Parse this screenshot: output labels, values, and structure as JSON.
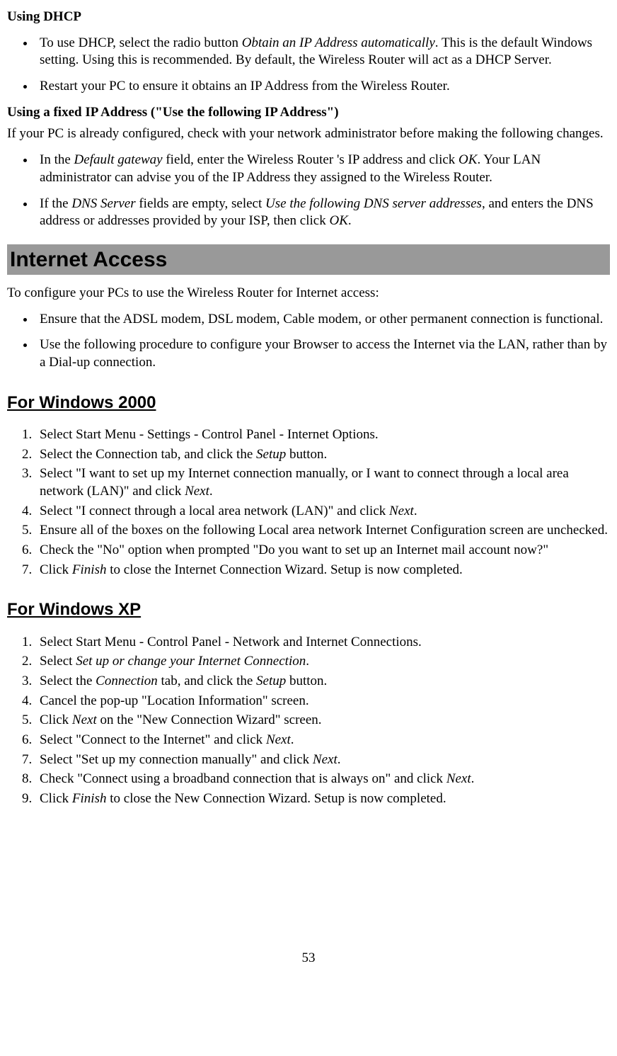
{
  "dhcp": {
    "title": "Using DHCP",
    "bullets": [
      {
        "pre": "To use DHCP, select the radio button ",
        "em": "Obtain an IP Address automatically",
        "post": ". This is the default Windows setting. Using this is recommended. By default, the Wireless  Router will act as a DHCP Server."
      },
      {
        "pre": "Restart your PC to ensure it obtains an IP Address from the Wireless  Router.",
        "em": "",
        "post": ""
      }
    ]
  },
  "fixed": {
    "title": "Using a fixed IP Address (\"Use the following IP Address\")",
    "intro": "If your PC is already configured, check with your network administrator before making the following changes.",
    "bullets": [
      {
        "segs": [
          "In the ",
          "Default gateway",
          " field, enter the Wireless  Router 's IP address and click ",
          "OK",
          ". Your LAN administrator can advise you of the IP Address they assigned to the Wireless  Router."
        ]
      },
      {
        "segs": [
          "If the ",
          "DNS Server",
          " fields are empty, select ",
          "Use the following DNS server addresses",
          ", and enters the DNS address or addresses provided by your ISP, then click ",
          "OK",
          "."
        ]
      }
    ]
  },
  "internet": {
    "title": "Internet Access",
    "intro": "To configure your PCs to use the Wireless  Router for Internet access:",
    "bullets": [
      "Ensure that the ADSL modem, DSL modem, Cable modem, or other permanent connection is functional.",
      "Use the following procedure to configure your Browser to access the Internet via the LAN, rather than by a Dial-up connection."
    ]
  },
  "win2000": {
    "title": "For Windows 2000",
    "steps": [
      {
        "segs": [
          "Select Start Menu - Settings - Control Panel - Internet Options."
        ]
      },
      {
        "segs": [
          "Select the Connection tab, and click the ",
          "Setup",
          " button."
        ]
      },
      {
        "segs": [
          "Select \"I want to set up my Internet connection manually, or I want to connect through a local area network (LAN)\" and click ",
          "Next",
          "."
        ]
      },
      {
        "segs": [
          "Select \"I connect through a local area network (LAN)\" and click ",
          "Next",
          "."
        ]
      },
      {
        "segs": [
          "Ensure all of the boxes on the following Local area network Internet Configuration screen are unchecked."
        ]
      },
      {
        "segs": [
          "Check the \"No\" option when prompted \"Do you want to set up an Internet mail account now?\""
        ]
      },
      {
        "segs": [
          "Click ",
          "Finish",
          " to close the Internet Connection Wizard. Setup is now completed."
        ]
      }
    ]
  },
  "winxp": {
    "title": "For Windows XP",
    "steps": [
      {
        "segs": [
          "Select Start Menu - Control Panel - Network and Internet Connections."
        ]
      },
      {
        "segs": [
          "Select ",
          "Set up or change your Internet Connection",
          "."
        ]
      },
      {
        "segs": [
          "Select the ",
          "Connection",
          " tab, and click the ",
          "Setup",
          " button."
        ]
      },
      {
        "segs": [
          "Cancel the pop-up \"Location Information\" screen."
        ]
      },
      {
        "segs": [
          "Click ",
          "Next",
          " on the \"New Connection Wizard\" screen."
        ]
      },
      {
        "segs": [
          "Select \"Connect to the Internet\" and click ",
          "Next",
          "."
        ]
      },
      {
        "segs": [
          "Select \"Set up my connection manually\" and click ",
          "Next",
          "."
        ]
      },
      {
        "segs": [
          "Check \"Connect using a broadband connection that is always on\" and click ",
          "Next",
          "."
        ]
      },
      {
        "segs": [
          "Click ",
          "Finish",
          " to close the New Connection Wizard. Setup is now completed."
        ]
      }
    ]
  },
  "page_number": "53"
}
